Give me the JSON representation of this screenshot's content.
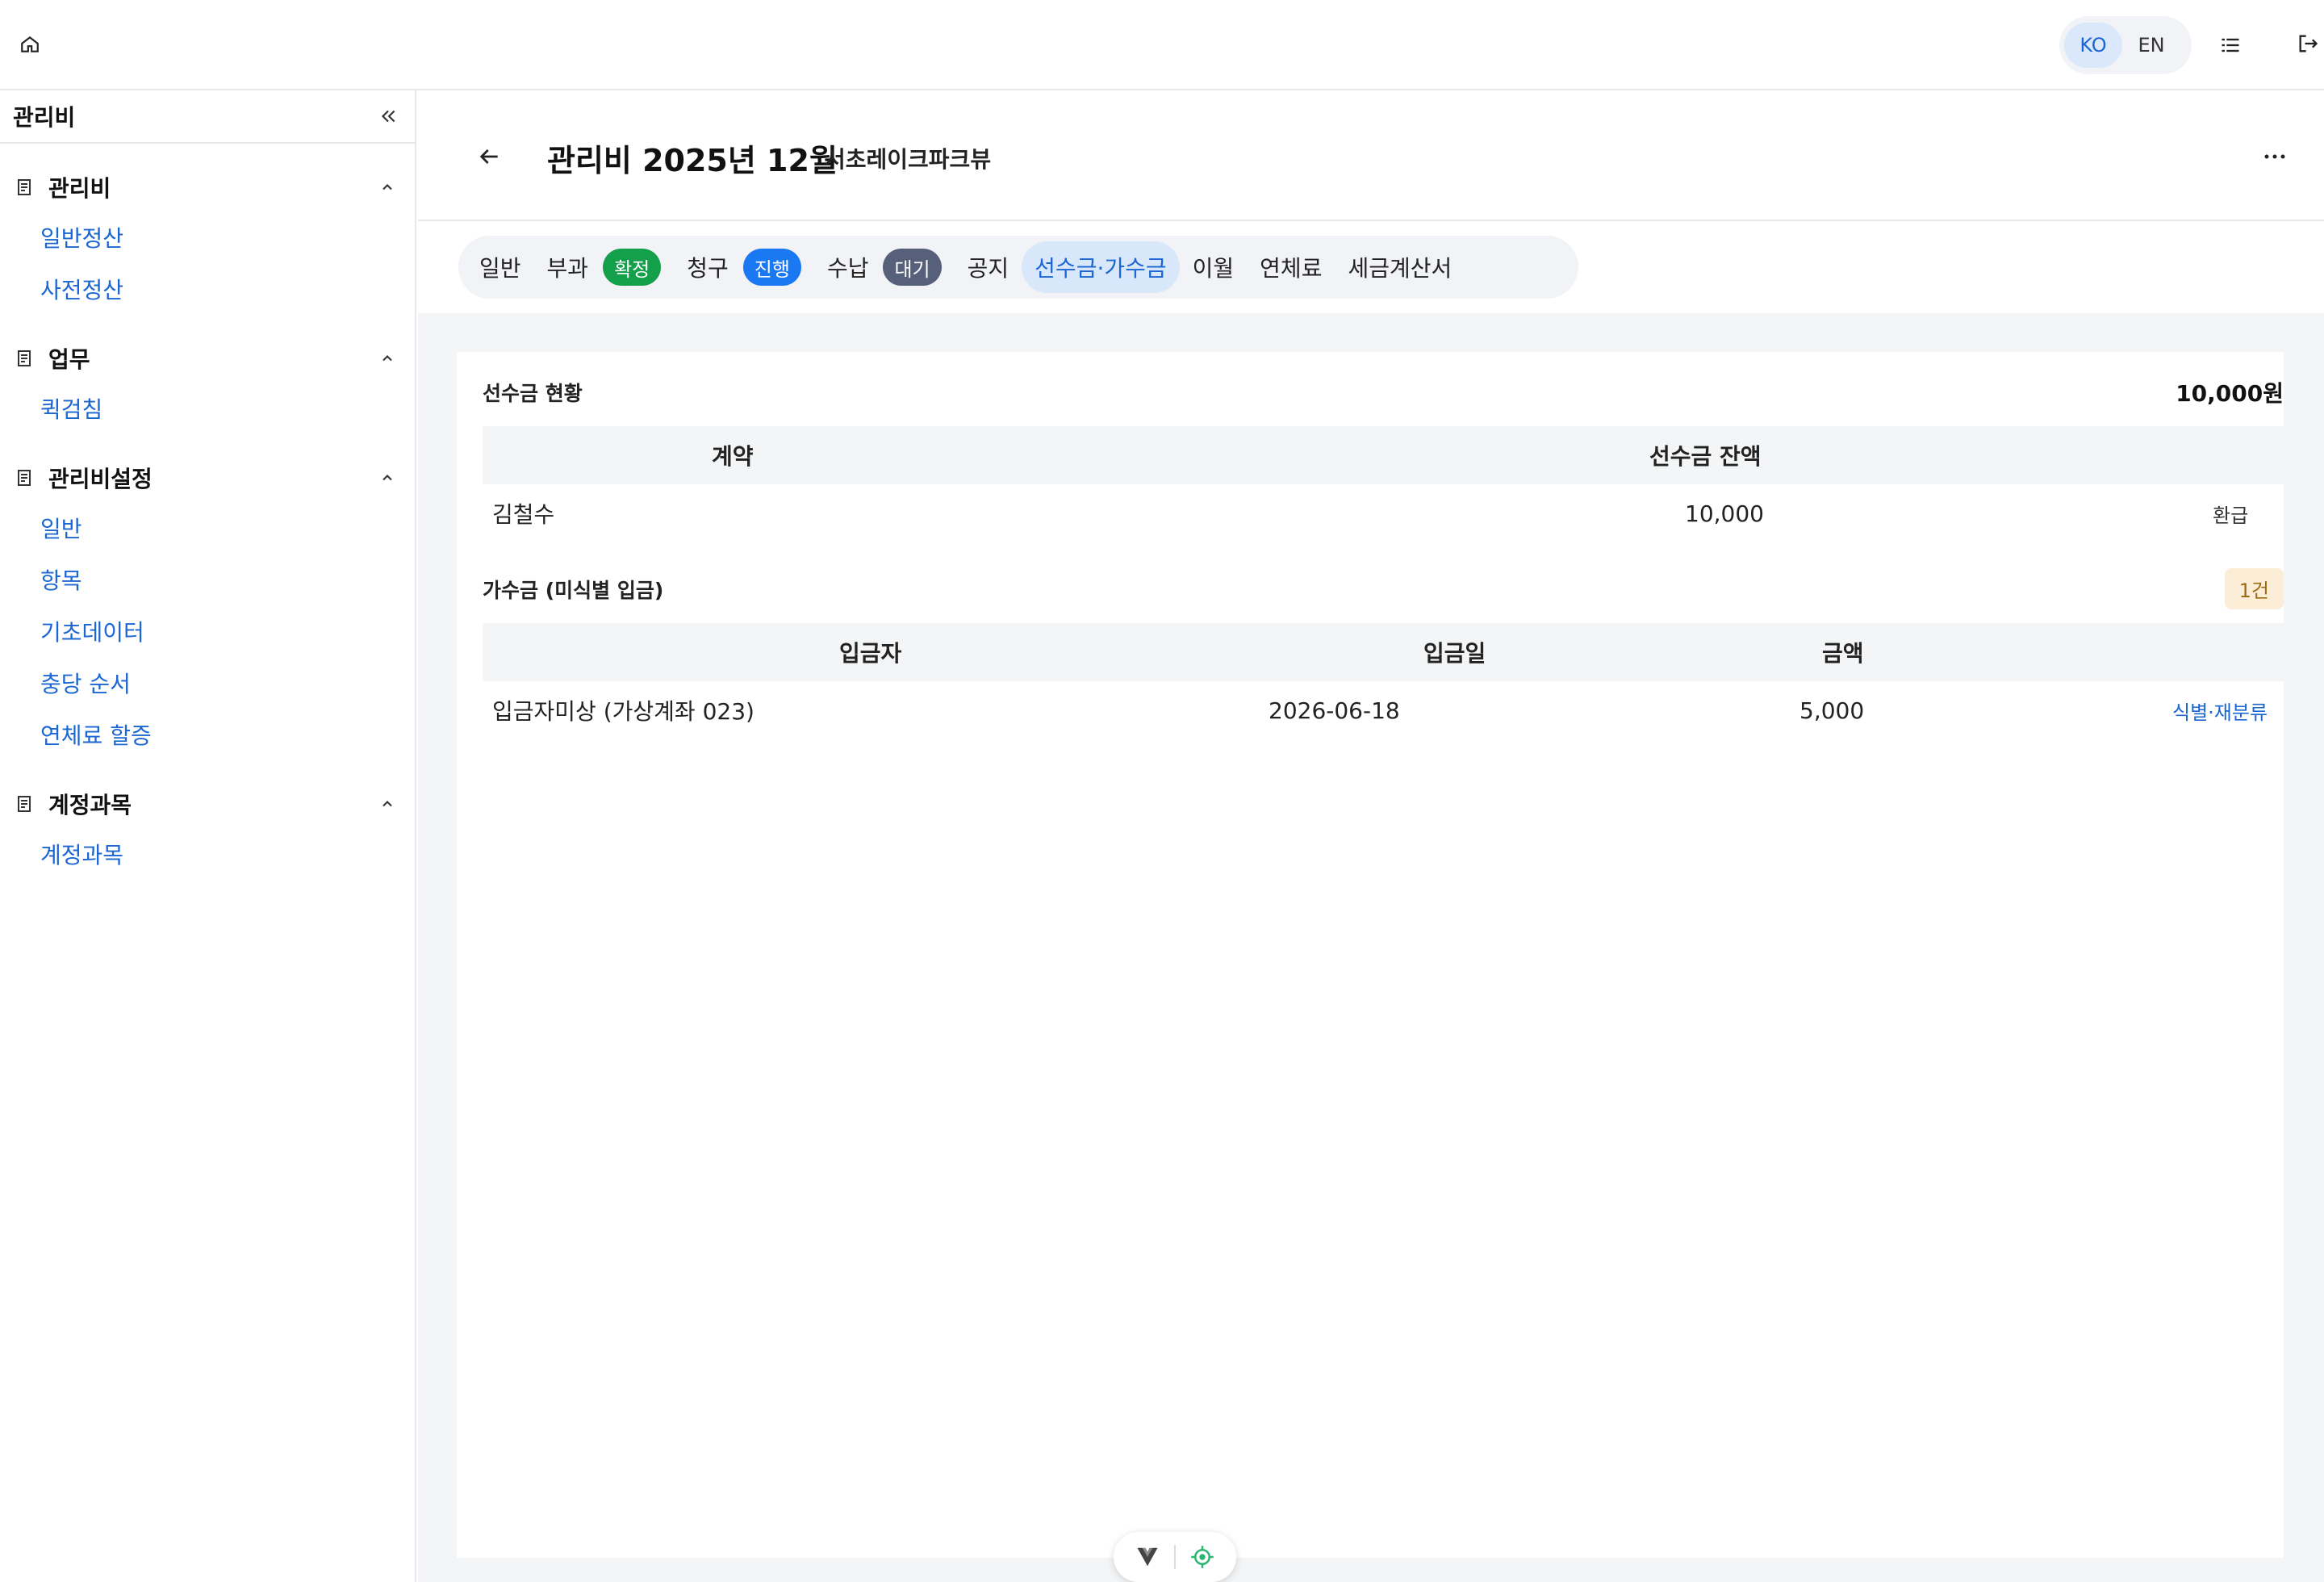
{
  "topbar": {
    "lang_ko": "KO",
    "lang_en": "EN",
    "icons": [
      "home-icon",
      "list-icon",
      "logout-icon"
    ]
  },
  "sidebar": {
    "title": "관리비",
    "groups": [
      {
        "label": "관리비",
        "items": [
          "일반정산",
          "사전정산"
        ]
      },
      {
        "label": "업무",
        "items": [
          "퀵검침"
        ]
      },
      {
        "label": "관리비설정",
        "items": [
          "일반",
          "항목",
          "기초데이터",
          "충당 순서",
          "연체료 할증"
        ]
      },
      {
        "label": "계정과목",
        "items": [
          "계정과목"
        ]
      }
    ]
  },
  "page": {
    "title": "관리비 2025년 12월",
    "subtitle": "서초레이크파크뷰"
  },
  "tabs": [
    {
      "label": "일반"
    },
    {
      "label": "부과",
      "badge": "확정",
      "badge_color": "#14a04b"
    },
    {
      "label": "청구",
      "badge": "진행",
      "badge_color": "#1a78f2"
    },
    {
      "label": "수납",
      "badge": "대기",
      "badge_color": "#56607a"
    },
    {
      "label": "공지"
    },
    {
      "label": "선수금·가수금",
      "active": true
    },
    {
      "label": "이월"
    },
    {
      "label": "연체료"
    },
    {
      "label": "세금계산서"
    }
  ],
  "prepaid": {
    "title": "선수금 현황",
    "total": "10,000원",
    "headers": [
      "계약",
      "선수금 잔액"
    ],
    "rows": [
      {
        "contract": "김철수",
        "balance": "10,000",
        "action": "환급"
      }
    ]
  },
  "suspense": {
    "title": "가수금 (미식별 입금)",
    "count": "1건",
    "headers": [
      "입금자",
      "입금일",
      "금액"
    ],
    "rows": [
      {
        "depositor": "입금자미상 (가상계좌 023)",
        "date": "2026-06-18",
        "amount": "5,000",
        "action": "식별·재분류"
      }
    ]
  },
  "colors": {
    "accent": "#1a66d2",
    "active_tab_bg": "#d9e7fb",
    "badge_confirmed": "#14a04b",
    "badge_progress": "#1a78f2",
    "badge_waiting": "#56607a",
    "count_badge_bg": "#fbedd6"
  }
}
